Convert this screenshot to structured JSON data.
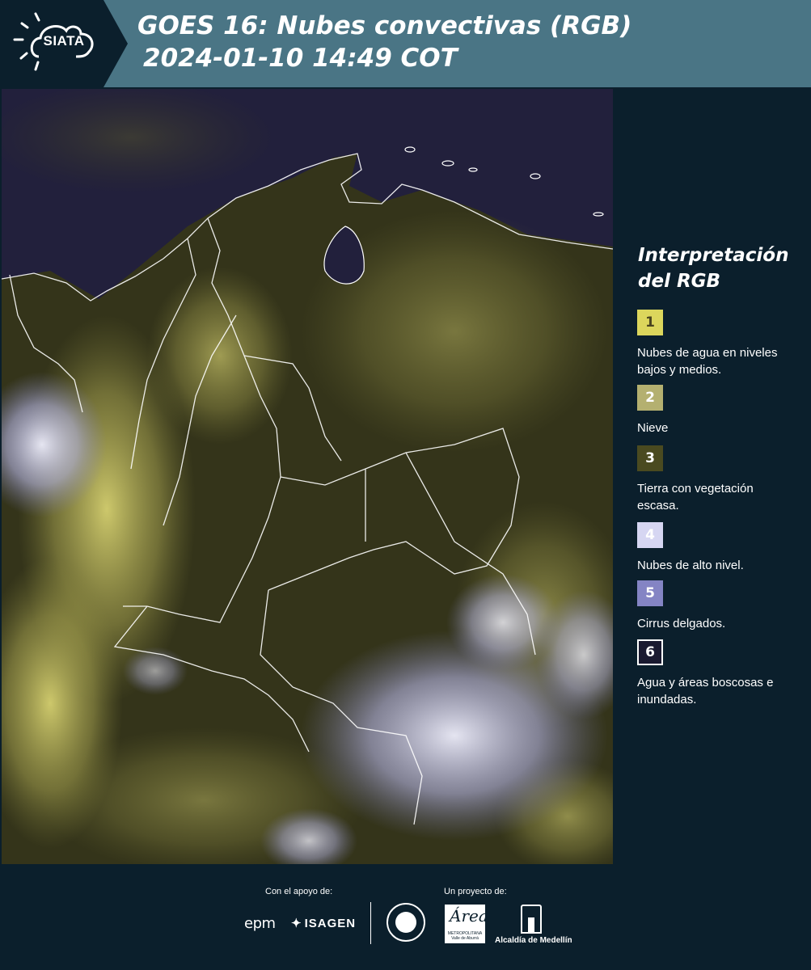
{
  "header": {
    "logo_text": "SIATA",
    "title_line1": "GOES 16: Nubes convectivas (RGB)",
    "title_line2": "2024-01-10 14:49 COT",
    "background_color": "#4a7585",
    "logo_block_color": "#0b1f2c"
  },
  "map": {
    "description_colors": {
      "ocean": "#23203f",
      "land_vegetation": "#3e3e1c",
      "low_clouds": "#e6e070",
      "high_clouds": "#d4d4f4",
      "borders": "#ffffff"
    }
  },
  "legend": {
    "title": "Interpretación del RGB",
    "items": [
      {
        "number": "1",
        "label": "Nubes de agua en niveles bajos y medios.",
        "color": "#dcd65c",
        "text_color": "#4a4420"
      },
      {
        "number": "2",
        "label": "Nieve",
        "color": "#b4b070",
        "text_color": "#ffffff"
      },
      {
        "number": "3",
        "label": "Tierra con vegetación escasa.",
        "color": "#4a4a20",
        "text_color": "#ffffff"
      },
      {
        "number": "4",
        "label": "Nubes de alto nivel.",
        "color": "#d6d6f2",
        "text_color": "#ffffff"
      },
      {
        "number": "5",
        "label": "Cirrus delgados.",
        "color": "#8484c4",
        "text_color": "#ffffff"
      },
      {
        "number": "6",
        "label": "Agua y áreas boscosas e inundadas.",
        "color": "#1a1a30",
        "text_color": "#ffffff"
      }
    ]
  },
  "footer": {
    "support_note": "Con el apoyo de:",
    "project_note": "Un proyecto de:",
    "epm": "epm",
    "isagen": "ISAGEN",
    "area_script": "Área",
    "area_sub": "METROPOLITANA Valle de Aburrá",
    "alcaldia": "Alcaldía de Medellín"
  }
}
